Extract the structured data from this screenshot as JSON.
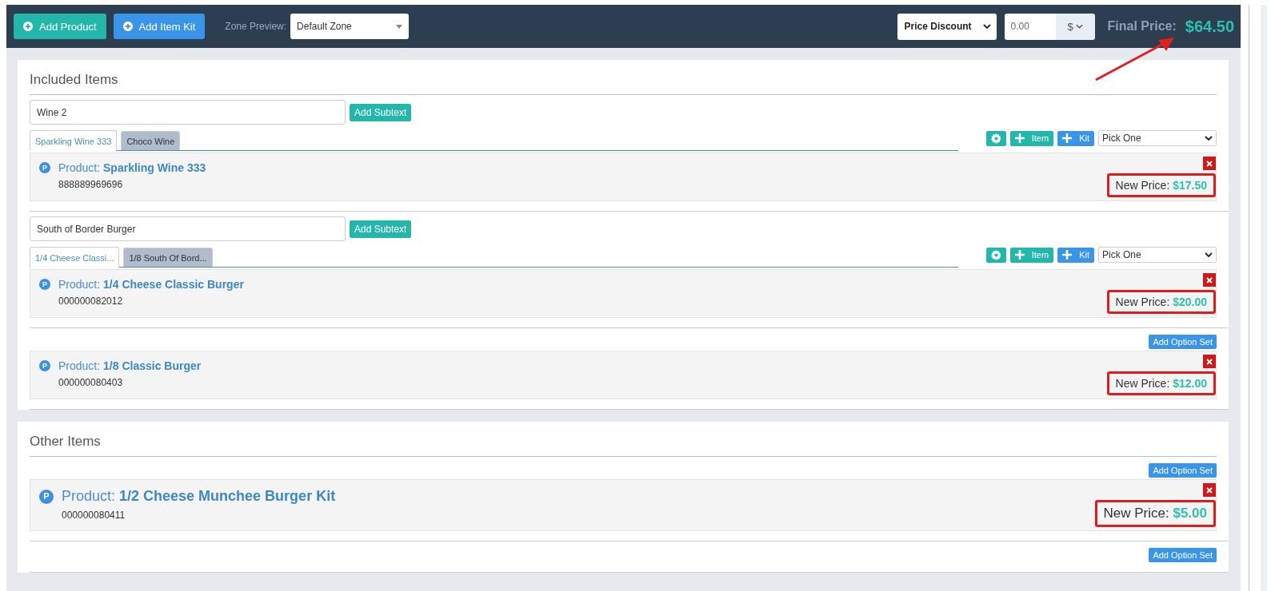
{
  "toolbar": {
    "buttons": [
      {
        "label": "Add Product",
        "kind": "teal"
      },
      {
        "label": "Add Item Kit",
        "kind": "blue"
      }
    ],
    "zone_label": "Zone Preview:",
    "zone_value": "Default Zone",
    "discount_type": "Price Discount",
    "discount_amount": "0.00",
    "unit": "$",
    "final_price_label": "Final Price:",
    "final_price": "$64.50"
  },
  "sections": [
    {
      "title": "Included Items",
      "groups": [
        {
          "kind": "tabs",
          "subtext": "Wine 2",
          "subtext_button": "Add Subtext",
          "tabs": [
            {
              "label": "Sparkling Wine 333",
              "selected": true
            },
            {
              "label": "Choco Wine",
              "selected": false
            }
          ],
          "tools": [
            {
              "kind": "gear"
            },
            {
              "kind": "item",
              "label": "Item"
            },
            {
              "kind": "kit",
              "label": "Kit"
            }
          ],
          "pick": "Pick One",
          "products": [
            {
              "badge": "P",
              "label": "Product:",
              "name": "Sparkling Wine 333",
              "sku": "888889969696",
              "price_label": "New Price:",
              "price": "$17.50",
              "large": false
            }
          ]
        },
        {
          "kind": "tabs",
          "subtext": "South of Border Burger",
          "subtext_button": "Add Subtext",
          "tabs": [
            {
              "label": "1/4 Cheese Classi...",
              "selected": true
            },
            {
              "label": "1/8 South Of Bord...",
              "selected": false
            }
          ],
          "tools": [
            {
              "kind": "gear"
            },
            {
              "kind": "item",
              "label": "Item"
            },
            {
              "kind": "kit",
              "label": "Kit"
            }
          ],
          "pick": "Pick One",
          "products": [
            {
              "badge": "P",
              "label": "Product:",
              "name": "1/4 Cheese Classic Burger",
              "sku": "000000082012",
              "price_label": "New Price:",
              "price": "$20.00",
              "large": false
            }
          ]
        },
        {
          "kind": "option",
          "option_button": "Add Option Set",
          "products": [
            {
              "badge": "P",
              "label": "Product:",
              "name": "1/8 Classic Burger",
              "sku": "000000080403",
              "price_label": "New Price:",
              "price": "$12.00",
              "large": false
            }
          ]
        }
      ]
    },
    {
      "title": "Other Items",
      "groups": [
        {
          "kind": "option",
          "option_button": "Add Option Set",
          "products": [
            {
              "badge": "P",
              "label": "Product:",
              "name": "1/2 Cheese Munchee Burger Kit",
              "sku": "000000080411",
              "price_label": "New Price:",
              "price": "$5.00",
              "large": true
            }
          ]
        },
        {
          "kind": "option",
          "option_button": "Add Option Set"
        }
      ]
    }
  ]
}
